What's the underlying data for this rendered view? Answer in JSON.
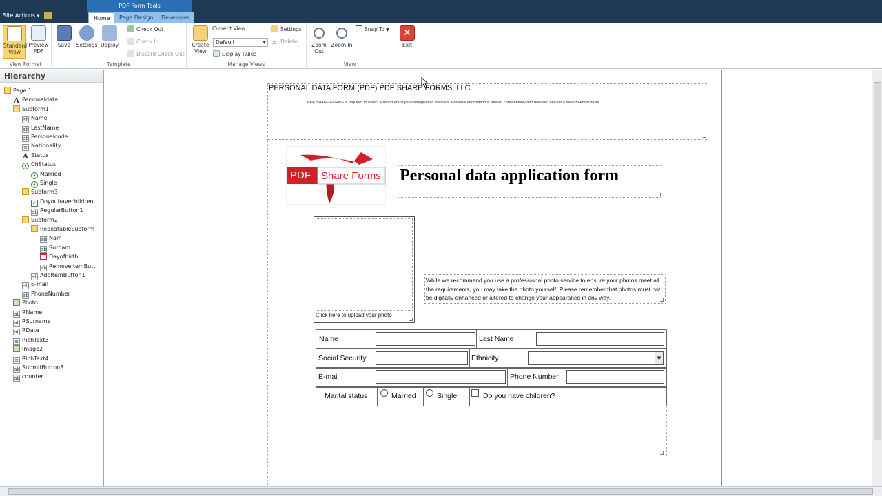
{
  "topbar": {
    "site_actions": "Site Actions",
    "tools_group": "PDF Form Tools",
    "tabs": [
      "Home",
      "Page Design",
      "Developer"
    ]
  },
  "ribbon": {
    "view_format": {
      "label": "View Format",
      "standard_view": "Standard View",
      "preview_pdf": "Preview PDF"
    },
    "template": {
      "label": "Template",
      "save": "Save",
      "settings": "Settings",
      "deploy": "Deploy",
      "check_out": "Check Out",
      "check_in": "Check In",
      "discard_check_out": "Discard Check Out"
    },
    "manage_views": {
      "label": "Manage Views",
      "create_view": "Create View",
      "current_view": "Current View",
      "current_view_value": "Default",
      "display_rules": "Display Rules",
      "settings": "Settings",
      "delete": "Delete"
    },
    "view": {
      "label": "View",
      "zoom_out": "Zoom Out",
      "zoom_in": "Zoom In",
      "snap_to": "Snap To"
    },
    "exit": "Exit"
  },
  "hierarchy": {
    "title": "Hierarchy",
    "items": [
      {
        "label": "Page 1",
        "icon": "folder-icon",
        "depth": 0
      },
      {
        "label": "Personaldata",
        "icon": "text-icon",
        "depth": 1
      },
      {
        "label": "Subform1",
        "icon": "folder-icon",
        "depth": 1
      },
      {
        "label": "Name",
        "icon": "textfield-icon",
        "depth": 2
      },
      {
        "label": "LastName",
        "icon": "textfield-icon",
        "depth": 2
      },
      {
        "label": "Personalcode",
        "icon": "textfield-icon",
        "depth": 2
      },
      {
        "label": "Nationality",
        "icon": "dropdown-icon",
        "depth": 2
      },
      {
        "label": "Status",
        "icon": "text-icon",
        "depth": 2
      },
      {
        "label": "ChStatus",
        "icon": "radio-icon",
        "depth": 2
      },
      {
        "label": "Married",
        "icon": "radio-icon",
        "depth": 3
      },
      {
        "label": "Single",
        "icon": "radio-icon",
        "depth": 3
      },
      {
        "label": "Subform3",
        "icon": "folder-icon",
        "depth": 2
      },
      {
        "label": "Doyouhavechildren",
        "icon": "checkbox-icon",
        "depth": 3
      },
      {
        "label": "RegularButton1",
        "icon": "button-icon",
        "depth": 3
      },
      {
        "label": "Subform2",
        "icon": "folder-icon",
        "depth": 2
      },
      {
        "label": "RepeatableSubform",
        "icon": "folder-icon",
        "depth": 3
      },
      {
        "label": "Nam",
        "icon": "textfield-icon",
        "depth": 4
      },
      {
        "label": "Surnam",
        "icon": "textfield-icon",
        "depth": 4
      },
      {
        "label": "Dayofbirth",
        "icon": "date-icon",
        "depth": 4
      },
      {
        "label": "RemoveItemButt",
        "icon": "button-icon",
        "depth": 4
      },
      {
        "label": "AddItemButton1",
        "icon": "button-icon",
        "depth": 3
      },
      {
        "label": "E-mail",
        "icon": "textfield-icon",
        "depth": 2
      },
      {
        "label": "PhoneNumber",
        "icon": "textfield-icon",
        "depth": 2
      },
      {
        "label": "Photo",
        "icon": "image-icon",
        "depth": 1
      },
      {
        "label": "RName",
        "icon": "textfield-icon",
        "depth": 1
      },
      {
        "label": "RSurname",
        "icon": "textfield-icon",
        "depth": 1
      },
      {
        "label": "RDate",
        "icon": "textfield-icon",
        "depth": 1
      },
      {
        "label": "RichText3",
        "icon": "richtext-icon",
        "depth": 1
      },
      {
        "label": "Image2",
        "icon": "image-icon",
        "depth": 1
      },
      {
        "label": "RichText4",
        "icon": "richtext-icon",
        "depth": 1
      },
      {
        "label": "SubmitButton3",
        "icon": "button-icon",
        "depth": 1
      },
      {
        "label": "counter",
        "icon": "textfield-icon",
        "depth": 1
      }
    ]
  },
  "form": {
    "header_title": "PERSONAL DATA FORM (PDF) PDF SHARE FORMS, LLC",
    "header_subtitle": "PDF SHARE FORMS is required to collect & report employee demographic statistics. Personal information is treated confidentially and released only on a need-to-know basis.",
    "logo_pdf": "PDF",
    "logo_share_forms": "Share Forms",
    "title": "Personal data application form",
    "photo_label": "Click here to upload your photo",
    "note": "While we recommend you use a professional photo service to ensure your photos meet all the requirements, you may take the photo yourself. Please remember that photos must not be digitally enhanced or altered to change your appearance in any way.",
    "fields": {
      "name": "Name",
      "last_name": "Last Name",
      "social_security": "Social Security",
      "ethnicity": "Ethnicity",
      "email": "E-mail",
      "phone_number": "Phone Number",
      "marital_status": "Marital status",
      "married": "Married",
      "single": "Single",
      "children": "Do you have children?"
    }
  },
  "colors": {
    "topbar": "#1f3a55",
    "tools_group": "#2a6fb3",
    "logo_red": "#d0202a"
  }
}
